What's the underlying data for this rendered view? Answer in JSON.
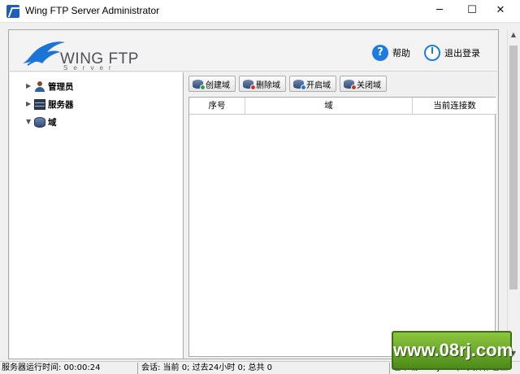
{
  "window": {
    "title": "Wing FTP Server Administrator",
    "minimize": "─",
    "maximize": "☐",
    "close": "✕"
  },
  "header": {
    "logo_text": "WING FTP",
    "logo_sub": "Server",
    "help_label": "帮助",
    "logout_label": "退出登录",
    "accent_color": "#1e7be0"
  },
  "tree": {
    "items": [
      {
        "label": "管理员",
        "icon": "admin-user-icon",
        "expanded": false
      },
      {
        "label": "服务器",
        "icon": "server-icon",
        "expanded": false
      },
      {
        "label": "域",
        "icon": "domain-icon",
        "expanded": true
      }
    ]
  },
  "toolbar": {
    "create": "创建域",
    "delete": "删除域",
    "start": "开启域",
    "stop": "关闭域"
  },
  "grid": {
    "columns": [
      "序号",
      "域",
      "当前连接数"
    ],
    "rows": []
  },
  "statusbar": {
    "uptime": "服务器运行时间: 00:00:24",
    "sessions": "会话: 当前 0;  过去24小时 0;  总共 0",
    "transfer": "已下载: 0 Bytes (0 文件);  已上"
  },
  "watermark": "www.08rj.com"
}
